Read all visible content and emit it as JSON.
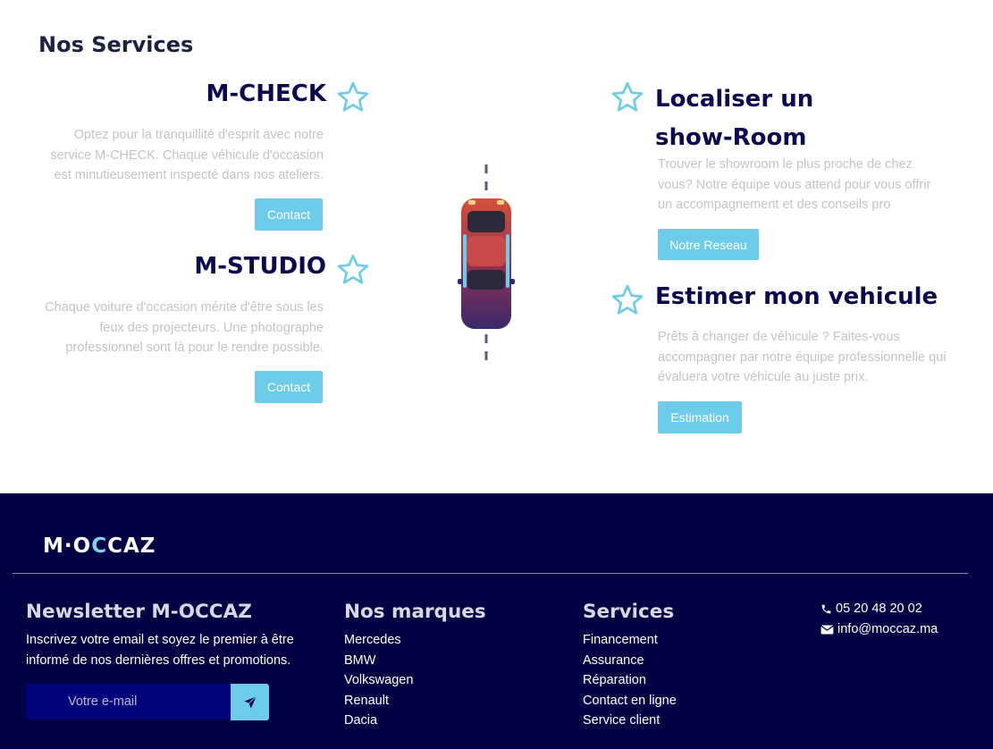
{
  "services": {
    "title": "Nos Services",
    "items": [
      {
        "title": "M-CHECK",
        "text": "Optez pour la tranquillité d'esprit avec notre service M-CHECK. Chaque véhicule d'occasion est minutieusement inspecté dans nos ateliers.",
        "button": "Contact"
      },
      {
        "title": "M-STUDIO",
        "text": "Chaque voiture d'occasion mérite d'être sous les feux des projecteurs. Une photographe professionnel sont là pour le rendre possible.",
        "button": "Contact"
      },
      {
        "title": "Localiser un show-Room",
        "text": "Trouver le showroom le plus proche de chez vous? Notre équipe vous attend pour vous offrir un accompagnement et des conseils pro",
        "button": "Notre Reseau"
      },
      {
        "title": "Estimer mon vehicule",
        "text": "Prêts à changer de véhicule ? Faites-vous accompagner par notre équipe professionnelle qui évaluera votre véhicule au juste prix.",
        "button": "Estimation"
      }
    ],
    "star_icon": "star-outline-icon",
    "car_image": "car-top-view-illustration"
  },
  "footer": {
    "logo": {
      "left": "M·O",
      "accent": "C",
      "right": "CAZ"
    },
    "newsletter": {
      "title": "Newsletter M-OCCAZ",
      "text": "Inscrivez votre email et soyez le premier à être informé de nos dernières offres et promotions.",
      "placeholder": "Votre e-mail",
      "send_icon": "paper-plane-icon"
    },
    "brands": {
      "title": "Nos marques",
      "items": [
        "Mercedes",
        "BMW",
        "Volkswagen",
        "Renault",
        "Dacia"
      ]
    },
    "services": {
      "title": "Services",
      "items": [
        "Financement",
        "Assurance",
        "Réparation",
        "Contact en ligne",
        "Service client"
      ]
    },
    "contact": {
      "phone": "05 20 48 20 02",
      "email": "info@moccaz.ma"
    }
  },
  "colors": {
    "accent": "#6cccea",
    "title": "#0a0950",
    "footer_bg": "#020144"
  }
}
